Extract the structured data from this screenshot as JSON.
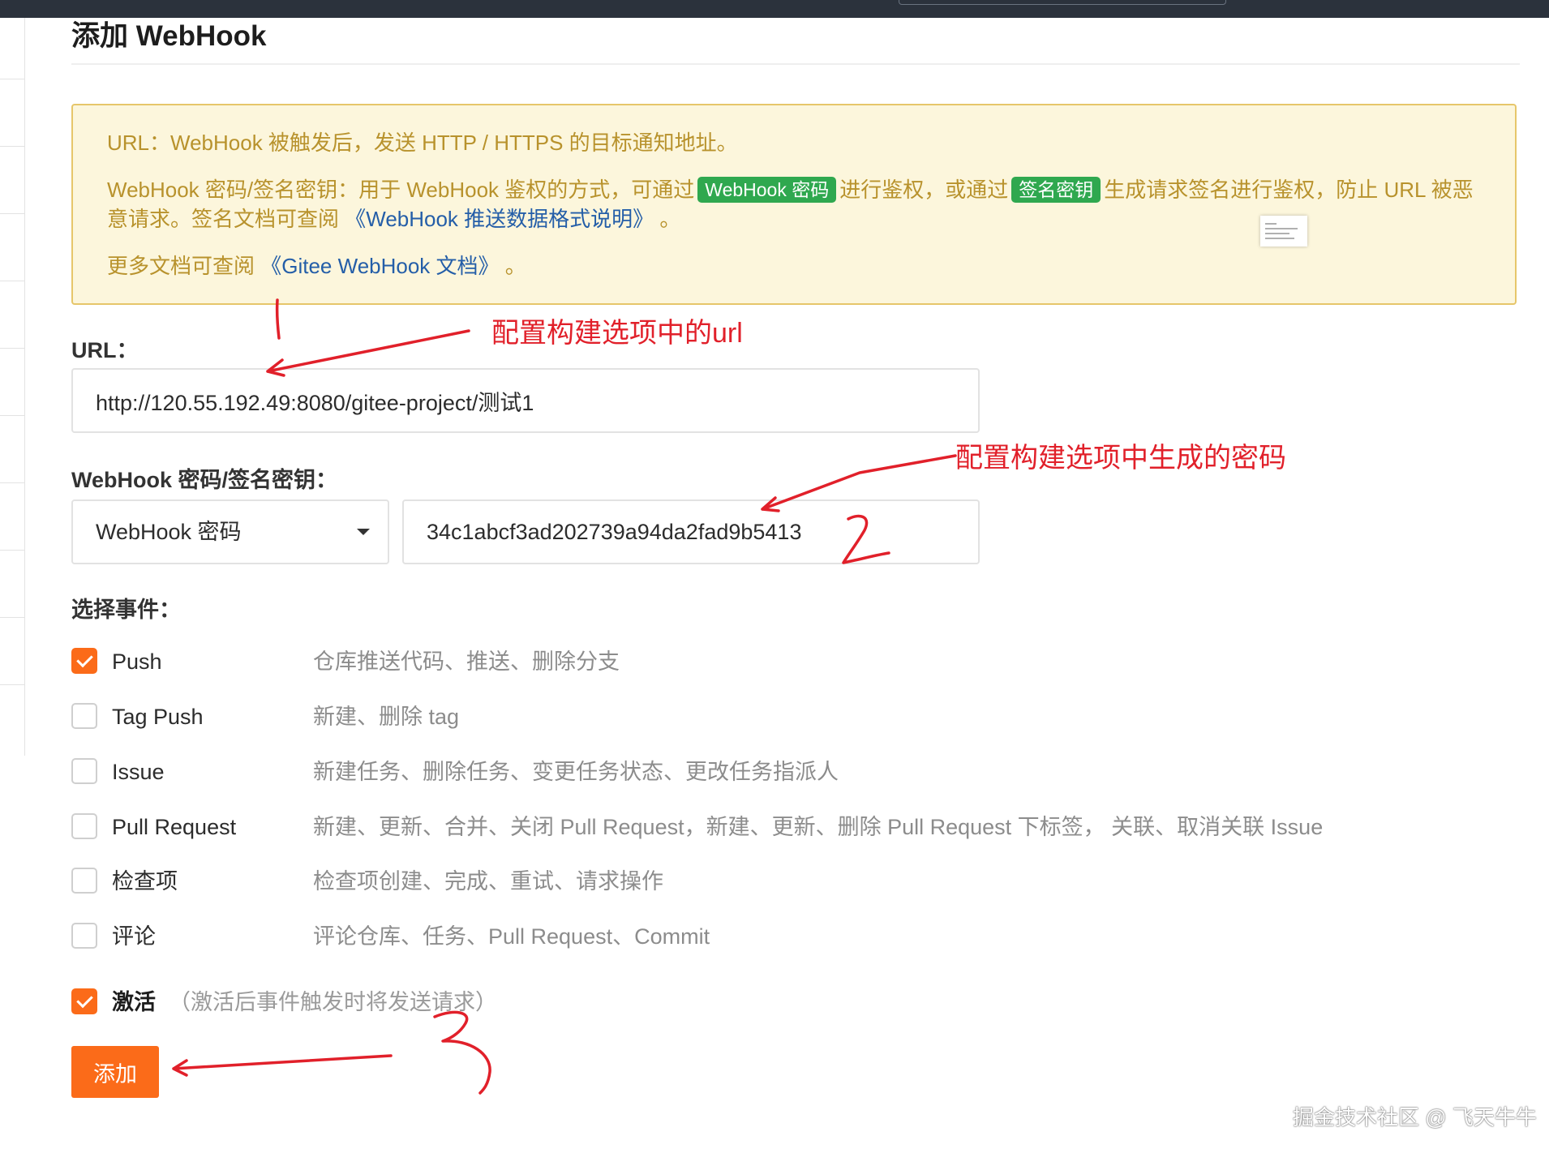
{
  "page": {
    "title": "添加 WebHook"
  },
  "notice": {
    "url_desc": "URL：WebHook 被触发后，发送 HTTP / HTTPS 的目标通知地址。",
    "secret_desc_before": "WebHook 密码/签名密钥：用于 WebHook 鉴权的方式，可通过",
    "tag_password": "WebHook 密码",
    "secret_desc_middle": "进行鉴权，或通过",
    "tag_signature": "签名密钥",
    "secret_desc_after": "生成请求签名进行鉴权，防止 URL 被恶意请求。签名文档可查阅",
    "format_doc_link": "《WebHook 推送数据格式说明》",
    "format_doc_suffix": "。",
    "more_docs_prefix": "更多文档可查阅",
    "gitee_doc_link": "《Gitee WebHook 文档》",
    "more_docs_suffix": "。"
  },
  "form": {
    "url_label": "URL：",
    "url_value": "http://120.55.192.49:8080/gitee-project/测试1",
    "secret_label": "WebHook 密码/签名密钥：",
    "secret_type_selected": "WebHook 密码",
    "secret_value": "34c1abcf3ad202739a94da2fad9b5413",
    "events_label": "选择事件："
  },
  "events": [
    {
      "name": "Push",
      "desc": "仓库推送代码、推送、删除分支",
      "checked": true
    },
    {
      "name": "Tag Push",
      "desc": "新建、删除 tag",
      "checked": false
    },
    {
      "name": "Issue",
      "desc": "新建任务、删除任务、变更任务状态、更改任务指派人",
      "checked": false
    },
    {
      "name": "Pull Request",
      "desc": "新建、更新、合并、关闭 Pull Request，新建、更新、删除 Pull Request 下标签， 关联、取消关联 Issue",
      "checked": false
    },
    {
      "name": "检查项",
      "desc": "检查项创建、完成、重试、请求操作",
      "checked": false
    },
    {
      "name": "评论",
      "desc": "评论仓库、任务、Pull Request、Commit",
      "checked": false
    }
  ],
  "active": {
    "label": "激活",
    "hint": "（激活后事件触发时将发送请求）",
    "checked": true
  },
  "submit": {
    "label": "添加"
  },
  "annotations": {
    "url_note": "配置构建选项中的url",
    "secret_note": "配置构建选项中生成的密码",
    "colors": {
      "annotation": "#e1202a",
      "accent": "#fb6b19",
      "tag": "#2fa84f",
      "notice_text": "#b8922c",
      "link": "#245ea8"
    }
  },
  "watermark": "掘金技术社区 @ 飞天牛牛"
}
